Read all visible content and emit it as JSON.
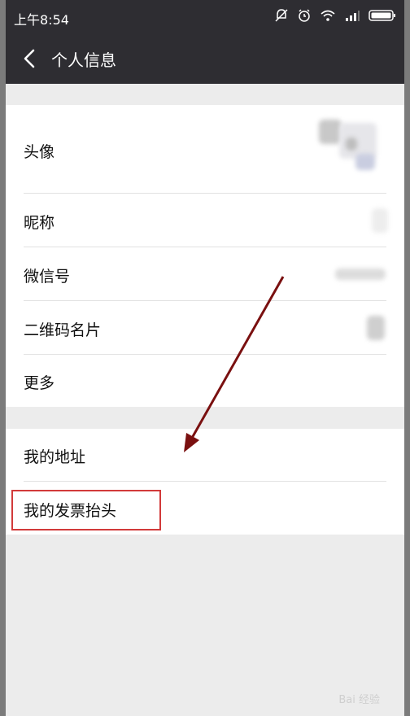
{
  "status": {
    "time": "上午8:54",
    "icons": [
      "bell-off-icon",
      "alarm-icon",
      "wifi-icon",
      "signal-icon",
      "battery-icon"
    ]
  },
  "nav": {
    "back_icon": "chevron-left-icon",
    "title": "个人信息"
  },
  "profile_section": {
    "items": [
      {
        "label": "头像"
      },
      {
        "label": "昵称"
      },
      {
        "label": "微信号"
      },
      {
        "label": "二维码名片"
      },
      {
        "label": "更多"
      }
    ]
  },
  "other_section": {
    "items": [
      {
        "label": "我的地址"
      },
      {
        "label": "我的发票抬头"
      }
    ]
  },
  "annotation": {
    "arrow_color": "#7a1010",
    "highlight_color": "#d23a3a"
  },
  "watermark": "Bai 经验"
}
